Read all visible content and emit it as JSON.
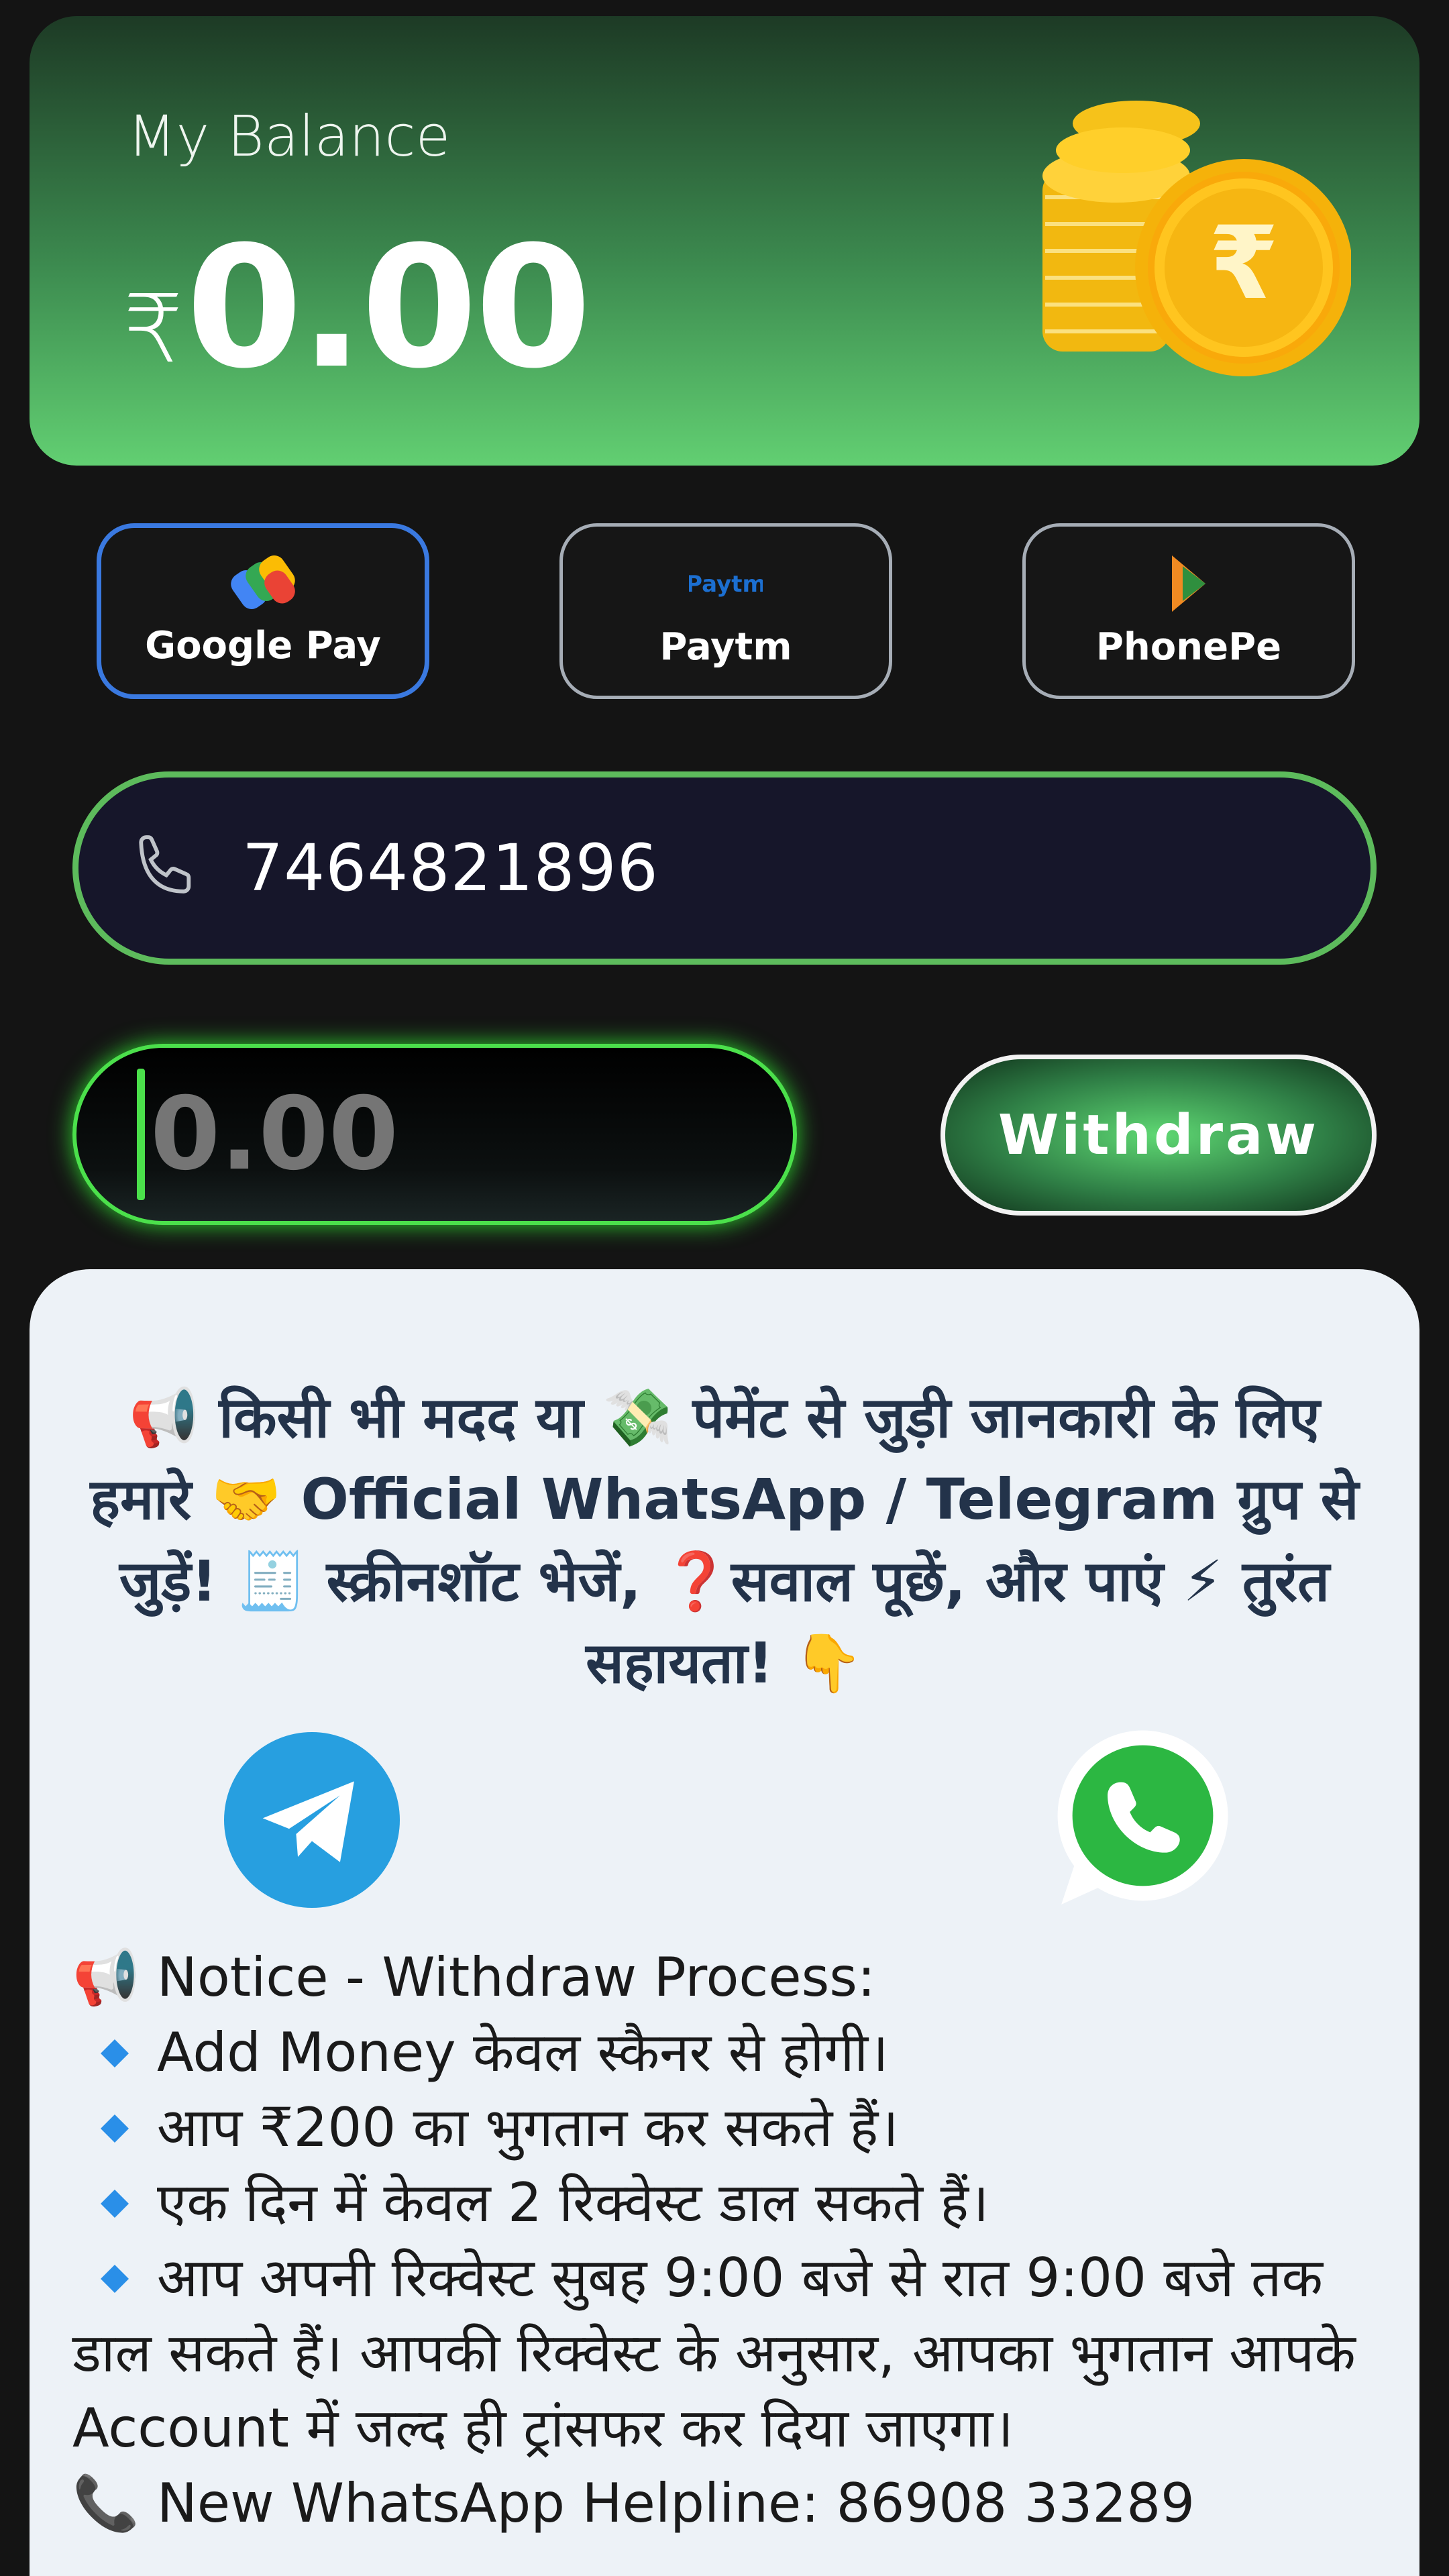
{
  "balance": {
    "label": "My Balance",
    "currency": "₹",
    "value": "0.00"
  },
  "payment_methods": [
    {
      "label": "Google Pay",
      "selected": true
    },
    {
      "label": "Paytm",
      "selected": false
    },
    {
      "label": "PhonePe",
      "selected": false
    }
  ],
  "paytm_logo_text": "Paytm",
  "phone": {
    "value": "7464821896"
  },
  "amount": {
    "placeholder": "0.00"
  },
  "withdraw_label": "Withdraw",
  "info": {
    "headline": "📢 किसी भी मदद या 💸 पेमेंट से जुड़ी जानकारी के लिए हमारे 🤝 Official WhatsApp / Telegram ग्रुप से जुड़ें! 🧾 स्क्रीनशॉट भेजें, ❓सवाल पूछें, और पाएं ⚡ तुरंत सहायता! 👇",
    "notice_title_emoji": "📢",
    "notice_title": "Notice - Withdraw Process:",
    "items": [
      "Add Money केवल स्कैनर से होगी।",
      "आप ₹200 का भुगतान कर सकते हैं।",
      "एक दिन में केवल 2 रिक्वेस्ट डाल सकते हैं।",
      "आप अपनी रिक्वेस्ट सुबह 9:00 बजे से रात 9:00 बजे तक"
    ],
    "continuation": "डाल सकते हैं। आपकी रिक्वेस्ट के अनुसार, आपका भुगतान आपके Account में जल्द ही ट्रांसफर कर दिया जाएगा।",
    "helpline_emoji": "📞",
    "helpline": "New WhatsApp Helpline: 86908 33289"
  },
  "colors": {
    "accent_green": "#5dbb5c",
    "selected_blue": "#3a79e0",
    "telegram_blue": "#279fe0",
    "whatsapp_green": "#2cb742"
  },
  "icons": [
    "coins-icon",
    "google-pay-icon",
    "paytm-icon",
    "phonepe-icon",
    "phone-icon",
    "telegram-icon",
    "whatsapp-icon",
    "diamond-bullet-icon"
  ]
}
